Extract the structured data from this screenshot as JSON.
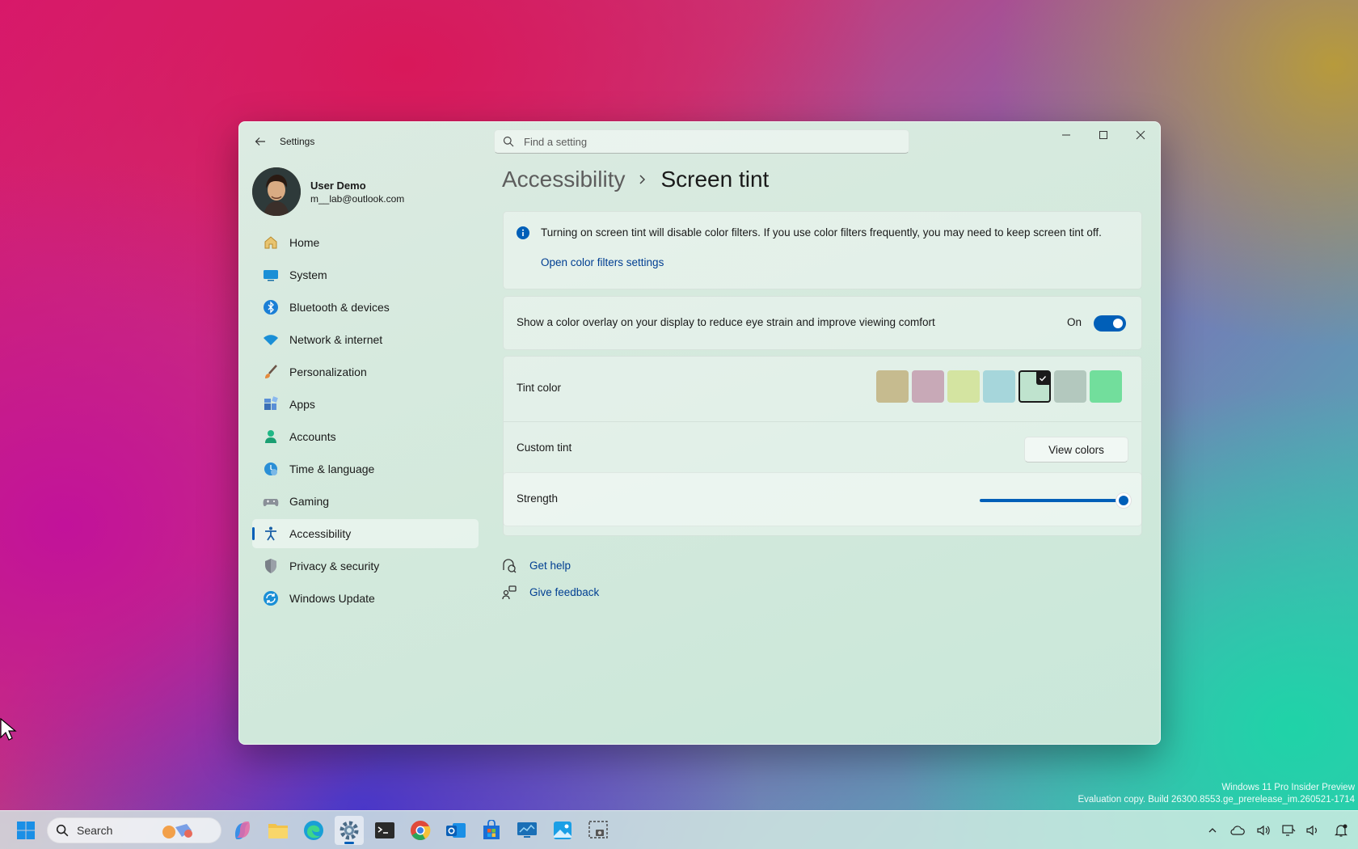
{
  "window": {
    "app_title": "Settings",
    "search_placeholder": "Find a setting"
  },
  "profile": {
    "name": "User Demo",
    "email": "m__lab@outlook.com"
  },
  "sidebar": {
    "items": [
      {
        "label": "Home",
        "icon": "home-icon"
      },
      {
        "label": "System",
        "icon": "system-icon"
      },
      {
        "label": "Bluetooth & devices",
        "icon": "bluetooth-icon"
      },
      {
        "label": "Network & internet",
        "icon": "wifi-icon"
      },
      {
        "label": "Personalization",
        "icon": "brush-icon"
      },
      {
        "label": "Apps",
        "icon": "apps-icon"
      },
      {
        "label": "Accounts",
        "icon": "accounts-icon"
      },
      {
        "label": "Time & language",
        "icon": "time-language-icon"
      },
      {
        "label": "Gaming",
        "icon": "gamepad-icon"
      },
      {
        "label": "Accessibility",
        "icon": "accessibility-icon",
        "selected": true
      },
      {
        "label": "Privacy & security",
        "icon": "shield-icon"
      },
      {
        "label": "Windows Update",
        "icon": "windows-update-icon"
      }
    ]
  },
  "breadcrumb": {
    "parent": "Accessibility",
    "current": "Screen tint"
  },
  "info": {
    "text": "Turning on screen tint will disable color filters. If you use color filters frequently, you may need to keep screen tint off.",
    "link": "Open color filters settings"
  },
  "overlay": {
    "label": "Show a color overlay on your display to reduce eye strain and improve viewing comfort",
    "state_label": "On",
    "enabled": true
  },
  "tint": {
    "label": "Tint color",
    "swatches": [
      "#c6bb8f",
      "#c8a9b7",
      "#d4e4a1",
      "#a6d6db",
      "#bfe3ce",
      "#b3c8be",
      "#72de9c"
    ],
    "selected_index": 4
  },
  "custom_tint": {
    "label": "Custom tint",
    "button": "View colors"
  },
  "strength": {
    "label": "Strength",
    "value_fraction": 1.0
  },
  "help": {
    "get_help": "Get help",
    "give_feedback": "Give feedback"
  },
  "watermark": {
    "line1": "Windows 11 Pro Insider Preview",
    "line2": "Evaluation copy. Build 26300.8553.ge_prerelease_im.260521-1714"
  },
  "taskbar": {
    "search_label": "Search"
  },
  "colors": {
    "accent": "#005fb8",
    "link": "#003e92"
  }
}
